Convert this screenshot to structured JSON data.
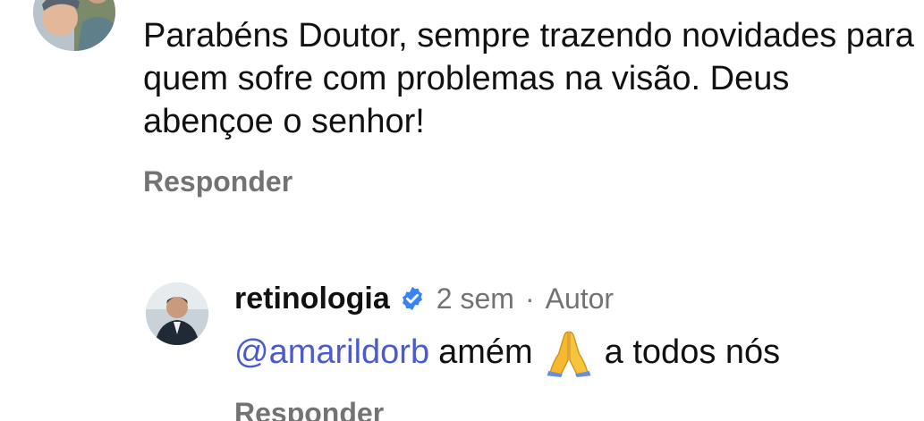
{
  "comment": {
    "text": "Parabéns Doutor, sempre trazendo novidades para\nquem sofre com problemas na visão. Deus\nabençoe o senhor!",
    "reply_label": "Responder"
  },
  "reply": {
    "username": "retinologia",
    "verified": true,
    "time": "2 sem",
    "separator": "·",
    "author_label": "Autor",
    "mention": "@amarildorb",
    "text_before_emoji": "amém",
    "emoji": "folded-hands",
    "text_after_emoji": "a todos nós",
    "reply_label": "Responder"
  },
  "colors": {
    "text": "#111111",
    "muted": "#737373",
    "mention": "#4a5bd0",
    "verified": "#3b82f6"
  }
}
